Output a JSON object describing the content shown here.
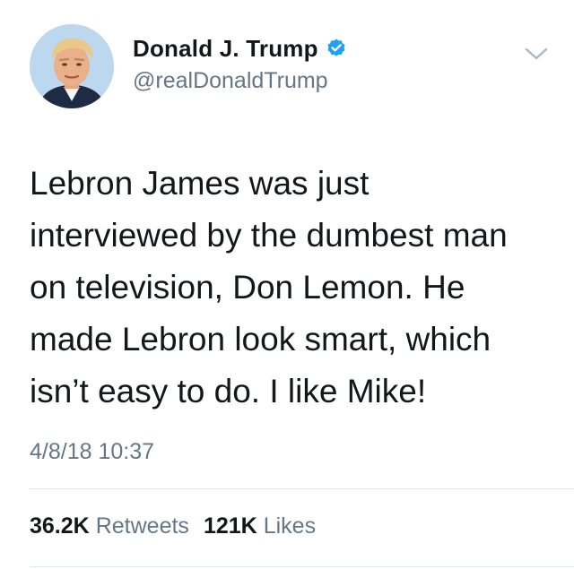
{
  "user": {
    "display_name": "Donald J. Trump",
    "handle": "@realDonaldTrump",
    "verified": true,
    "avatar_icon": "profile-photo",
    "verified_color": "#1da1f2"
  },
  "tweet": {
    "text": "Lebron James was just\ninterviewed by the dumbest man\non television, Don Lemon. He\nmade Lebron look smart, which\nisn’t easy to do. I like Mike!",
    "timestamp": "4/8/18 10:37"
  },
  "stats": {
    "retweets_count": "36.2K",
    "retweets_label": "Retweets",
    "likes_count": "121K",
    "likes_label": "Likes"
  },
  "menu_icon": "chevron-down-icon"
}
